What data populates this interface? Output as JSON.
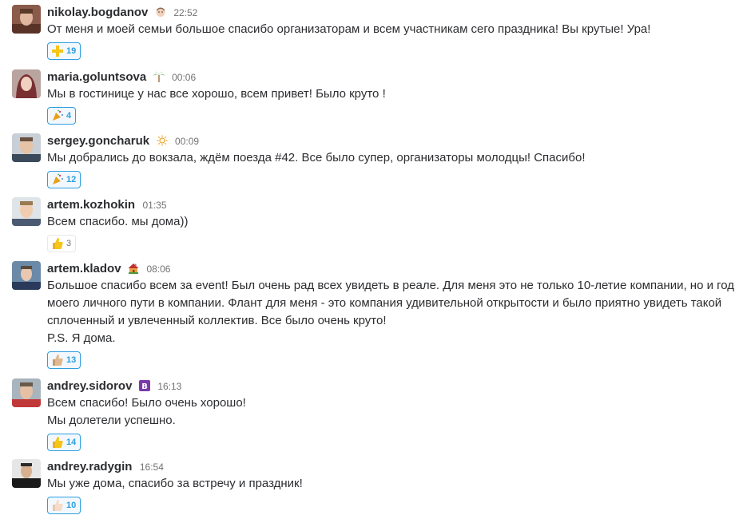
{
  "messages": [
    {
      "author": "nikolay.bogdanov",
      "status_icon": "man-face-icon",
      "time": "22:52",
      "lines": [
        "От меня и моей семьи большое спасибо организаторам и всем участникам сего праздника! Вы крутые! Ура!"
      ],
      "reaction": {
        "emoji": "heavy-plus-icon",
        "count": "19",
        "highlighted": true
      }
    },
    {
      "author": "maria.goluntsova",
      "status_icon": "palm-tree-icon",
      "time": "00:06",
      "lines": [
        "Мы в гостинице у нас все хорошо, всем привет! Было круто !"
      ],
      "reaction": {
        "emoji": "party-popper-icon",
        "count": "4",
        "highlighted": true
      }
    },
    {
      "author": "sergey.goncharuk",
      "status_icon": "sun-icon",
      "time": "00:09",
      "lines": [
        "Мы добрались до вокзала, ждём поезда #42. Все было супер, организаторы молодцы! Спасибо!"
      ],
      "reaction": {
        "emoji": "party-popper-icon",
        "count": "12",
        "highlighted": true
      }
    },
    {
      "author": "artem.kozhokin",
      "status_icon": "",
      "time": "01:35",
      "lines": [
        "Всем спасибо. мы дома))"
      ],
      "reaction": {
        "emoji": "thumbs-up-icon",
        "count": "3",
        "highlighted": false
      }
    },
    {
      "author": "artem.kladov",
      "status_icon": "house-icon",
      "time": "08:06",
      "lines": [
        "Большое спасибо всем за event! Был очень рад всех увидеть в реале. Для меня это не только 10-летие компании, но и год",
        "моего личного пути в компании. Флант для меня - это компания удивительной открытости и было приятно увидеть такой",
        "сплоченный и увлеченный коллектив. Все было очень круто!",
        "P.S. Я дома."
      ],
      "reaction": {
        "emoji": "thumbs-up-light-icon",
        "count": "13",
        "highlighted": true
      }
    },
    {
      "author": "andrey.sidorov",
      "status_icon": "b-letter-icon",
      "time": "16:13",
      "lines": [
        "Всем спасибо! Было очень хорошо!",
        "Мы долетели успешно."
      ],
      "reaction": {
        "emoji": "thumbs-up-icon",
        "count": "14",
        "highlighted": true
      }
    },
    {
      "author": "andrey.radygin",
      "status_icon": "",
      "time": "16:54",
      "lines": [
        "Мы уже дома, спасибо за встречу и праздник!"
      ],
      "reaction": {
        "emoji": "thumbs-up-pale-icon",
        "count": "10",
        "highlighted": true
      }
    }
  ],
  "colors": {
    "link": "#2d9ee0",
    "text": "#2c2d30",
    "muted": "#717274"
  }
}
